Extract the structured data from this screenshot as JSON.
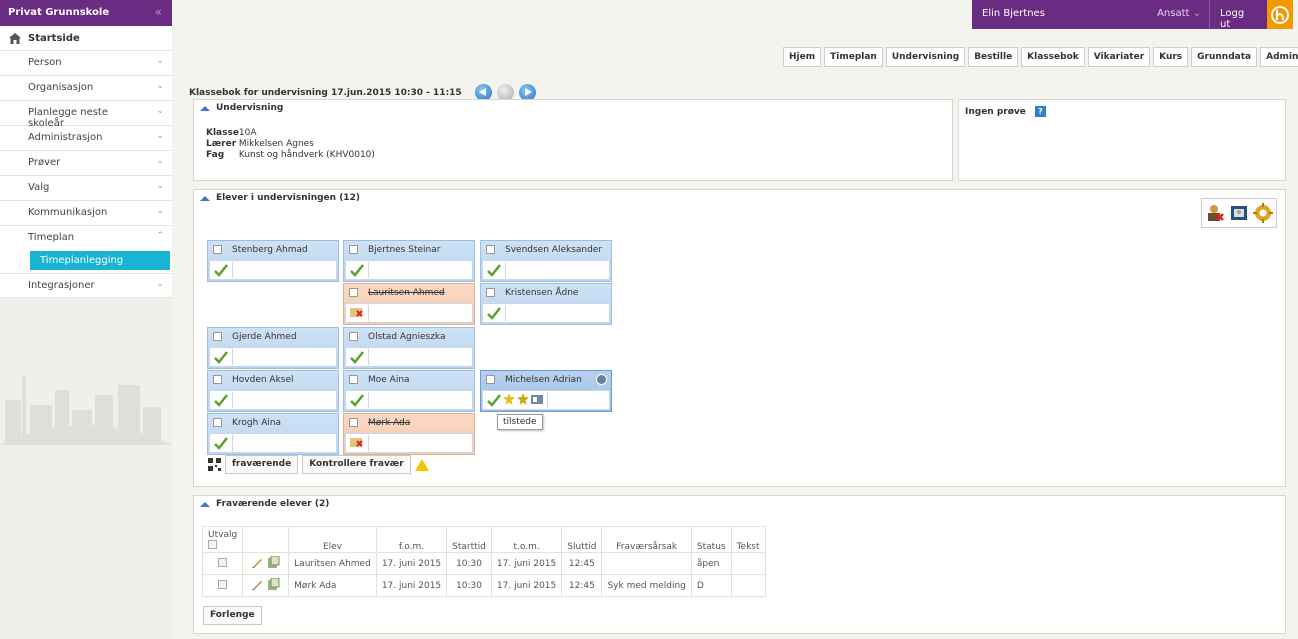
{
  "brand": {
    "title": "Privat Grunnskole",
    "collapse": "«"
  },
  "menu": {
    "home": "Startside",
    "items": [
      {
        "label": "Person"
      },
      {
        "label": "Organisasjon"
      },
      {
        "label": "Planlegge neste skoleår"
      },
      {
        "label": "Administrasjon"
      },
      {
        "label": "Prøver"
      },
      {
        "label": "Valg"
      },
      {
        "label": "Kommunikasjon"
      },
      {
        "label": "Timeplan"
      }
    ],
    "sub_item": "Timeplanlegging",
    "last_item": "Integrasjoner"
  },
  "user": {
    "name": "Elin Bjertnes",
    "role": "Ansatt",
    "logout": "Logg ut"
  },
  "navtabs": [
    "Hjem",
    "Timeplan",
    "Undervisning",
    "Bestille",
    "Klassebok",
    "Vikariater",
    "Kurs",
    "Grunndata",
    "Administrasjon"
  ],
  "page_title": "Klassebok for undervisning 17.jun.2015 10:30 - 11:15",
  "undervisning": {
    "title": "Undervisning",
    "klasse_label": "Klasse",
    "klasse": "10A",
    "laerer_label": "Lærer",
    "laerer": "Mikkelsen Agnes",
    "fag_label": "Fag",
    "fag": "Kunst og håndverk (KHV0010)"
  },
  "prove": {
    "title": "Ingen prøve",
    "help": "?"
  },
  "elever": {
    "title": "Elever i undervisningen (12)",
    "students": [
      {
        "name": "Stenberg Ahmad",
        "status": "present"
      },
      {
        "name": "Bjertnes Steinar",
        "status": "present"
      },
      {
        "name": "Svendsen Aleksander",
        "status": "present"
      },
      {
        "name": "Lauritsen Ahmed",
        "status": "absent"
      },
      {
        "name": "Kristensen Ådne",
        "status": "present"
      },
      {
        "name": "Gjerde Ahmed",
        "status": "present"
      },
      {
        "name": "Olstad Agnieszka",
        "status": "present"
      },
      {
        "name": "Hovden Aksel",
        "status": "present"
      },
      {
        "name": "Moe Aina",
        "status": "present"
      },
      {
        "name": "Michelsen Adrian",
        "status": "present"
      },
      {
        "name": "Krogh Aina",
        "status": "present"
      },
      {
        "name": "Mørk Ada",
        "status": "absent"
      }
    ],
    "tooltip": "tilstede",
    "btn_fravaerende": "fraværende",
    "btn_kontrollere": "Kontrollere fravær"
  },
  "fravaer": {
    "title": "Fraværende elever (2)",
    "columns": [
      "Utvalg",
      "",
      "Elev",
      "f.o.m.",
      "Starttid",
      "t.o.m.",
      "Sluttid",
      "Fraværsårsak",
      "Status",
      "Tekst"
    ],
    "rows": [
      {
        "elev": "Lauritsen Ahmed",
        "fom": "17. juni 2015",
        "start": "10:30",
        "tom": "17. juni 2015",
        "slutt": "12:45",
        "arsak": "",
        "status": "åpen",
        "tekst": ""
      },
      {
        "elev": "Mørk Ada",
        "fom": "17. juni 2015",
        "start": "10:30",
        "tom": "17. juni 2015",
        "slutt": "12:45",
        "arsak": "Syk med melding",
        "status": "D",
        "tekst": ""
      }
    ],
    "btn_forlenge": "Forlenge"
  },
  "colors": {
    "brand": "#6a2b82",
    "accent": "#19b3d4",
    "logo": "#f39a00",
    "present_card": "#c5dcf3",
    "absent_card": "#f8cfb8"
  }
}
